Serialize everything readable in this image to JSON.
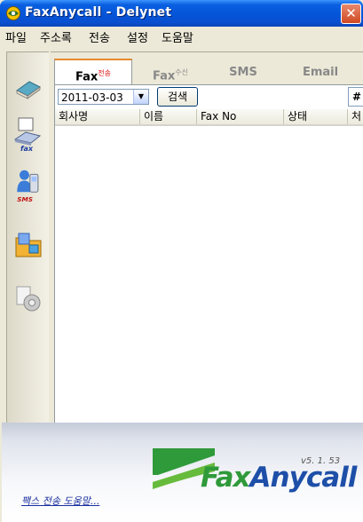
{
  "window": {
    "title": "FaxAnycall - Delynet",
    "close_symbol": "✕"
  },
  "menu": [
    "파일",
    "주소록",
    "전송",
    "설정",
    "도움말"
  ],
  "sidebar": {
    "icons": [
      "book-icon",
      "fax-icon",
      "sms-icon",
      "folder-icon",
      "settings-icon"
    ],
    "fax_label": "fax",
    "sms_label": "SMS"
  },
  "tabs": [
    {
      "label": "Fax",
      "sup": "전송"
    },
    {
      "label": "Fax",
      "sup": "수신"
    },
    {
      "label": "SMS",
      "sup": ""
    },
    {
      "label": "Email",
      "sup": ""
    }
  ],
  "toolbar": {
    "date": "2011-03-03",
    "dropdown_symbol": "▼",
    "search_label": "검색",
    "hash_label": "#"
  },
  "table": {
    "columns": [
      "회사명",
      "이름",
      "Fax No",
      "상태",
      "처"
    ]
  },
  "scrollbar": {
    "left_symbol": "◀",
    "right_symbol": "▶",
    "thumb_grip": "|||"
  },
  "footer": {
    "help_link": "팩스 전송 도움말...",
    "version": "v5. 1. 53",
    "logo_fax": "Fax",
    "logo_anycall": "Anycall"
  },
  "colors": {
    "title_blue": "#0454d8",
    "tab_active_accent": "#e68b2c",
    "logo_green": "#2f9a3a",
    "logo_blue": "#1d4fa8"
  }
}
